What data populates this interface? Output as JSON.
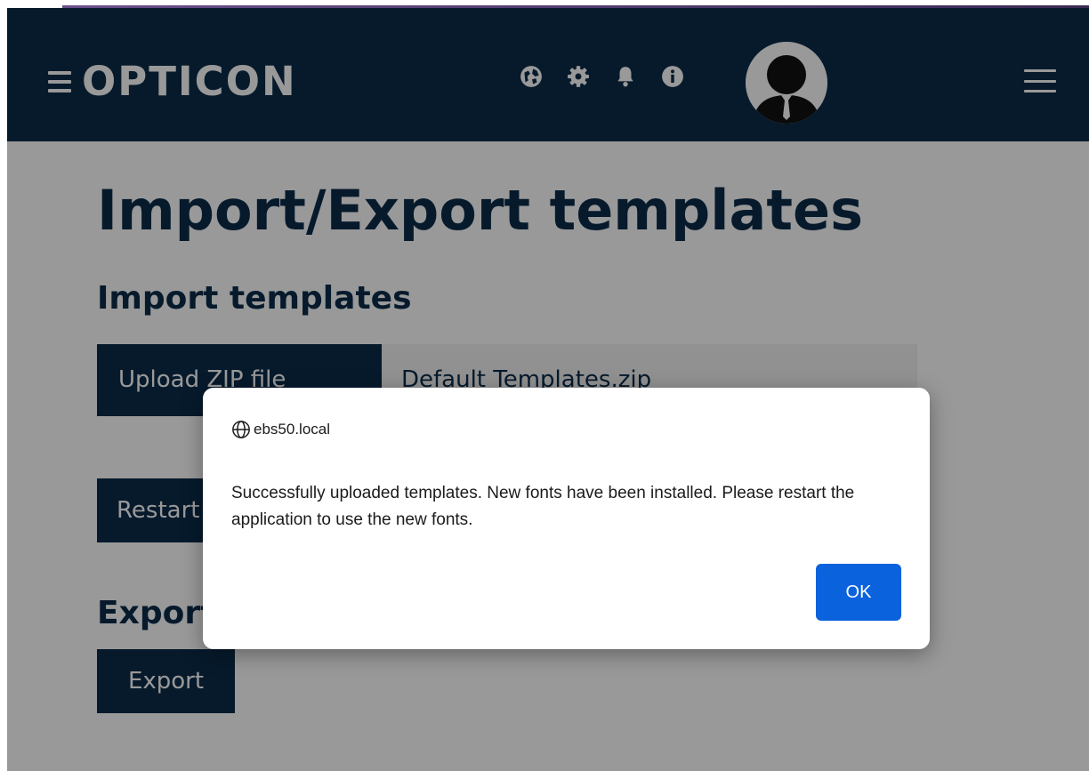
{
  "header": {
    "brand": "OPTICON",
    "icons": [
      "globe-icon",
      "gear-icon",
      "bell-icon",
      "info-icon",
      "avatar",
      "hamburger-menu-icon"
    ]
  },
  "main": {
    "title": "Import/Export templates",
    "import_heading": "Import templates",
    "upload_button": "Upload ZIP file",
    "file_name": "Default Templates.zip",
    "restart_button": "Restart",
    "export_heading": "Export",
    "export_button": "Export"
  },
  "dialog": {
    "origin": "ebs50.local",
    "message": "Successfully uploaded templates. New fonts have been installed. Please restart the application to use the new fonts.",
    "ok_label": "OK"
  },
  "colors": {
    "header_bg": "#0b2c4a",
    "primary_text": "#0b2c4a",
    "ok_button": "#0a62dd"
  }
}
